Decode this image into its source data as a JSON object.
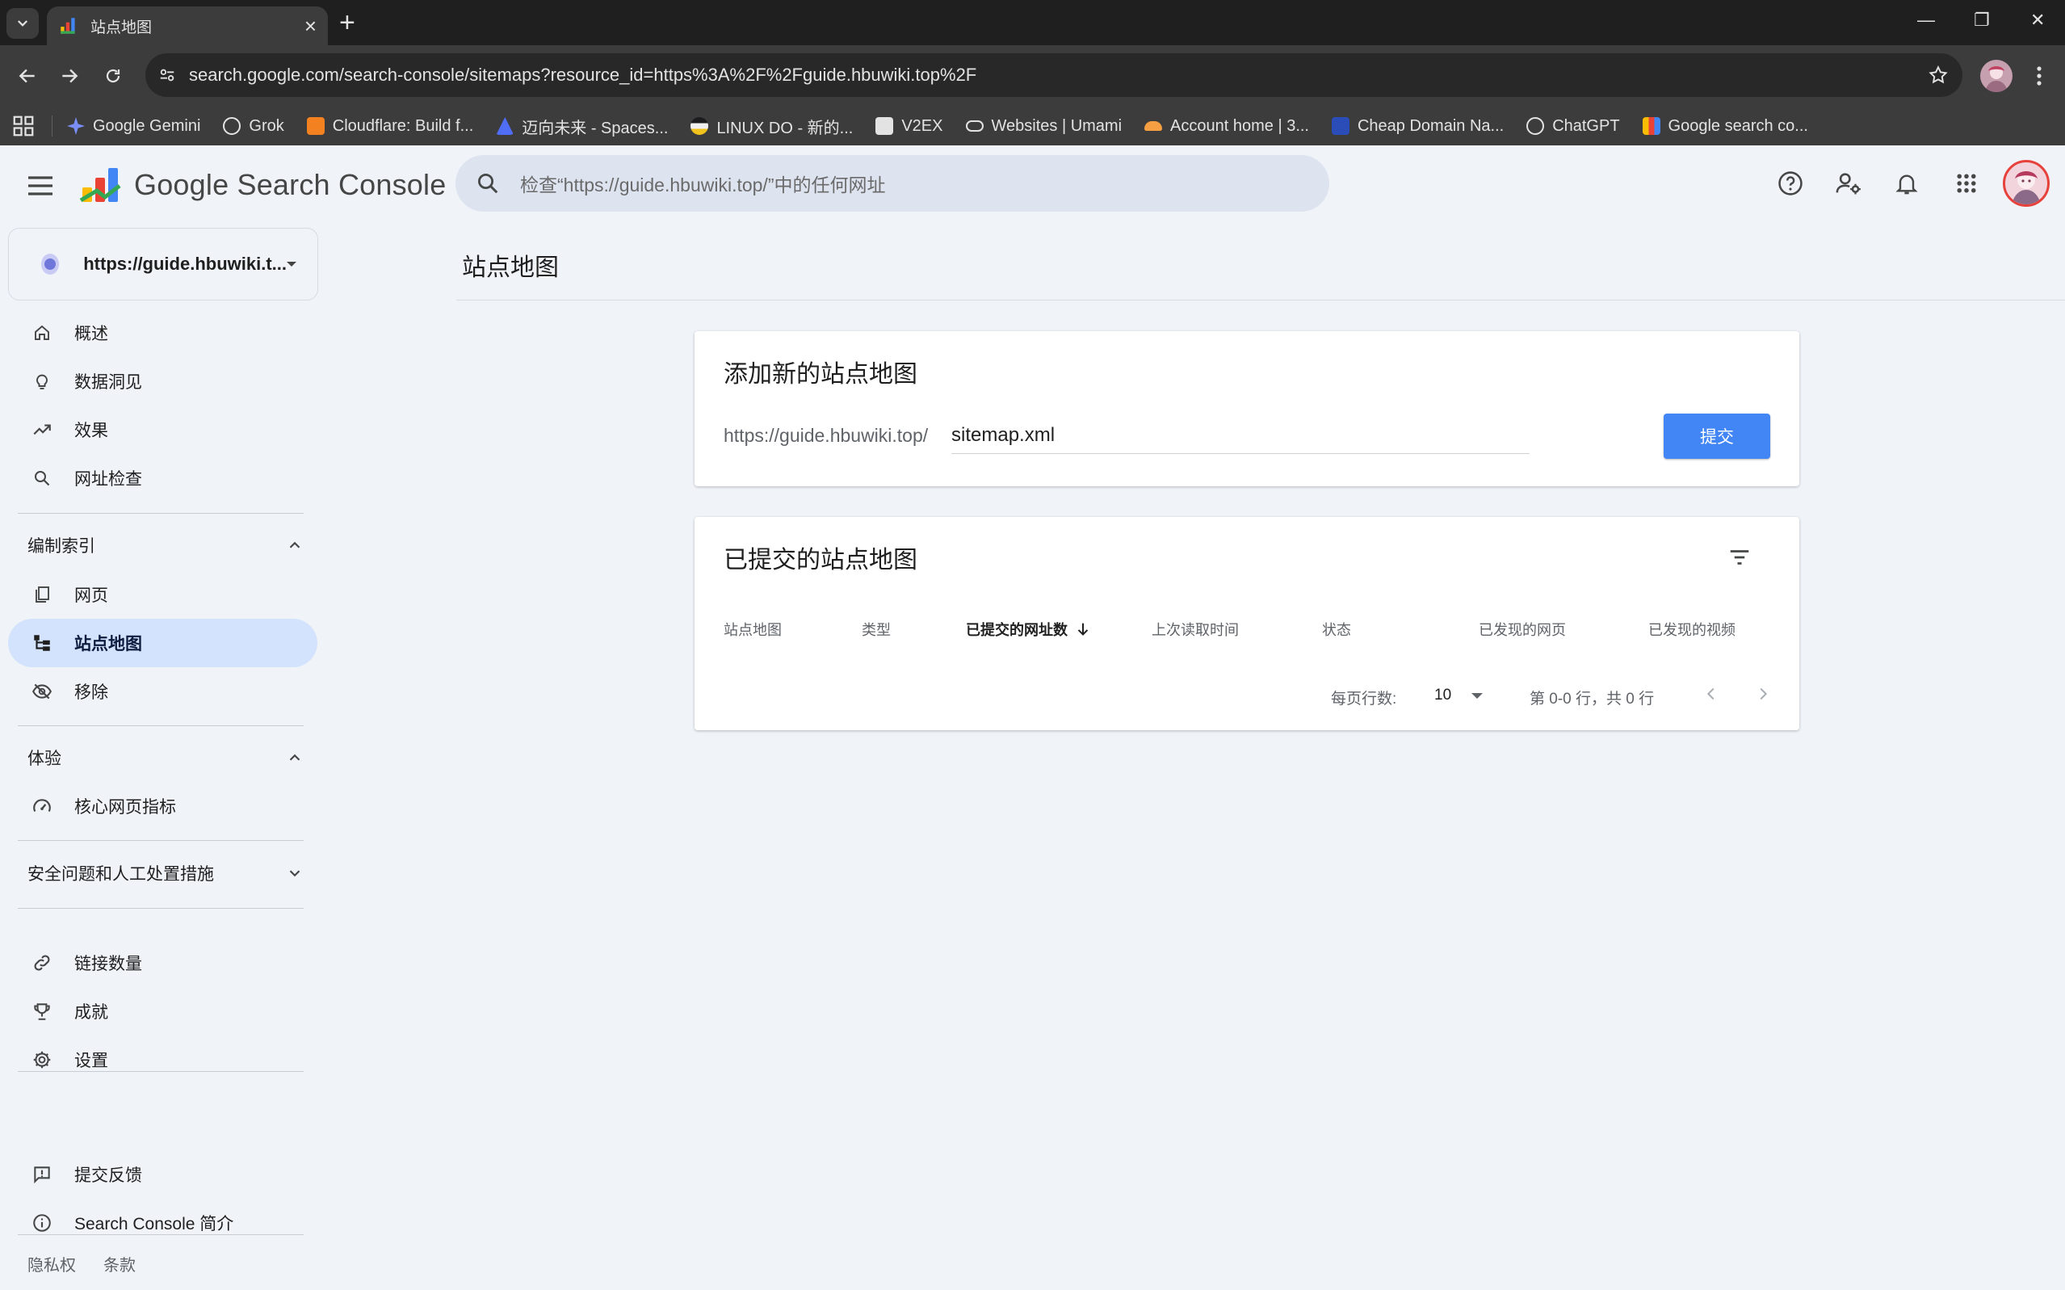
{
  "browser": {
    "tab_title": "站点地图",
    "url": "search.google.com/search-console/sitemaps?resource_id=https%3A%2F%2Fguide.hbuwiki.top%2F",
    "bookmarks": [
      {
        "label": "Google Gemini",
        "color": "#7b8ef7"
      },
      {
        "label": "Grok",
        "color": "#e3e3e3"
      },
      {
        "label": "Cloudflare: Build f...",
        "color": "#f48120"
      },
      {
        "label": "迈向未来 - Spaces...",
        "color": "#4f6df5"
      },
      {
        "label": "LINUX DO - 新的...",
        "color": "#f1c21b"
      },
      {
        "label": "V2EX",
        "color": "#e3e3e3"
      },
      {
        "label": "Websites | Umami",
        "color": "#e3e3e3"
      },
      {
        "label": "Account home | 3...",
        "color": "#f59e42"
      },
      {
        "label": "Cheap Domain Na...",
        "color": "#2a4db7"
      },
      {
        "label": "ChatGPT",
        "color": "#e3e3e3"
      },
      {
        "label": "Google search co...",
        "color": "#fbbc04"
      }
    ]
  },
  "header": {
    "app_name": "Google Search Console",
    "search_placeholder": "检查“https://guide.hbuwiki.top/”中的任何网址"
  },
  "property": {
    "value": "https://guide.hbuwiki.t..."
  },
  "sidebar": {
    "items_top": [
      "概述",
      "数据洞见",
      "效果",
      "网址检查"
    ],
    "section_index": "编制索引",
    "items_index": [
      "网页",
      "站点地图",
      "移除"
    ],
    "section_experience": "体验",
    "items_experience": [
      "核心网页指标"
    ],
    "section_security": "安全问题和人工处置措施",
    "items_bottom": [
      "链接数量",
      "成就",
      "设置"
    ],
    "items_footer": [
      "提交反馈",
      "Search Console 简介"
    ],
    "links": [
      "隐私权",
      "条款"
    ]
  },
  "main": {
    "page_title": "站点地图",
    "add_card": {
      "title": "添加新的站点地图",
      "prefix": "https://guide.hbuwiki.top/",
      "input_value": "sitemap.xml",
      "submit_label": "提交"
    },
    "submitted_card": {
      "title": "已提交的站点地图",
      "columns": [
        "站点地图",
        "类型",
        "已提交的网址数",
        "上次读取时间",
        "状态",
        "已发现的网页",
        "已发现的视频"
      ],
      "rows_per_page_label": "每页行数:",
      "rows_per_page_value": "10",
      "range_text": "第 0-0 行，共 0 行"
    }
  },
  "colors": {
    "accent": "#4285f4",
    "active_nav": "#d3e3fd",
    "background": "#f0f4f9"
  }
}
